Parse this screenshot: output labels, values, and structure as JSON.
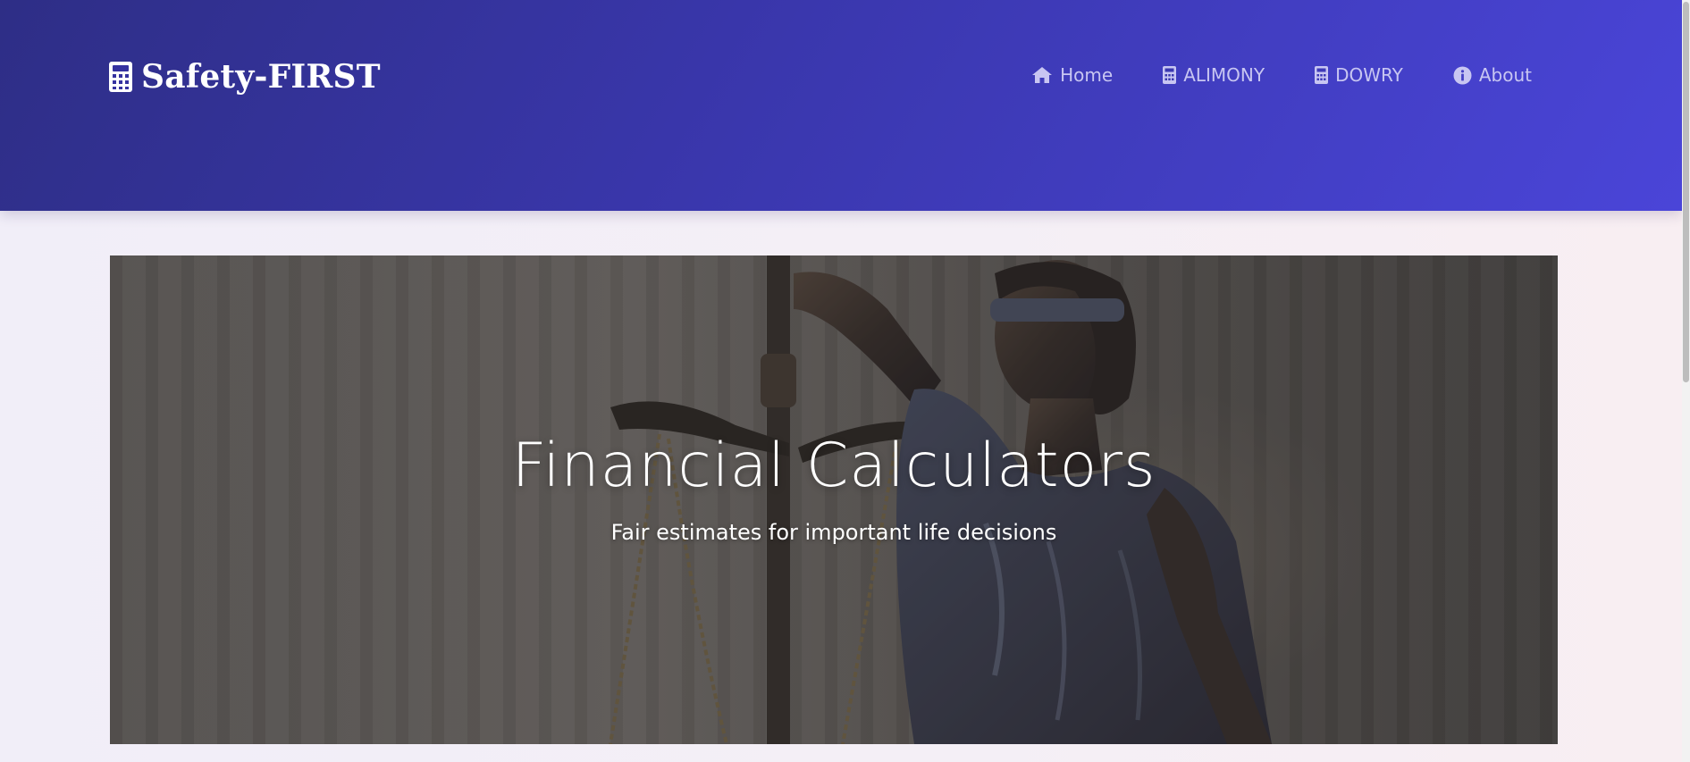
{
  "brand": {
    "name": "Safety-FIRST",
    "icon": "calculator-icon"
  },
  "nav": {
    "items": [
      {
        "label": "Home",
        "icon": "home-icon"
      },
      {
        "label": "ALIMONY",
        "icon": "calculator-icon"
      },
      {
        "label": "DOWRY",
        "icon": "calculator-icon"
      },
      {
        "label": "About",
        "icon": "info-circle-icon"
      }
    ]
  },
  "hero": {
    "title": "Financial Calculators",
    "subtitle": "Fair estimates for important life decisions"
  },
  "colors": {
    "header_start": "#2e2e86",
    "header_end": "#4a45d8",
    "nav_text": "#c8c6f2",
    "page_background": "#f3eff6"
  }
}
